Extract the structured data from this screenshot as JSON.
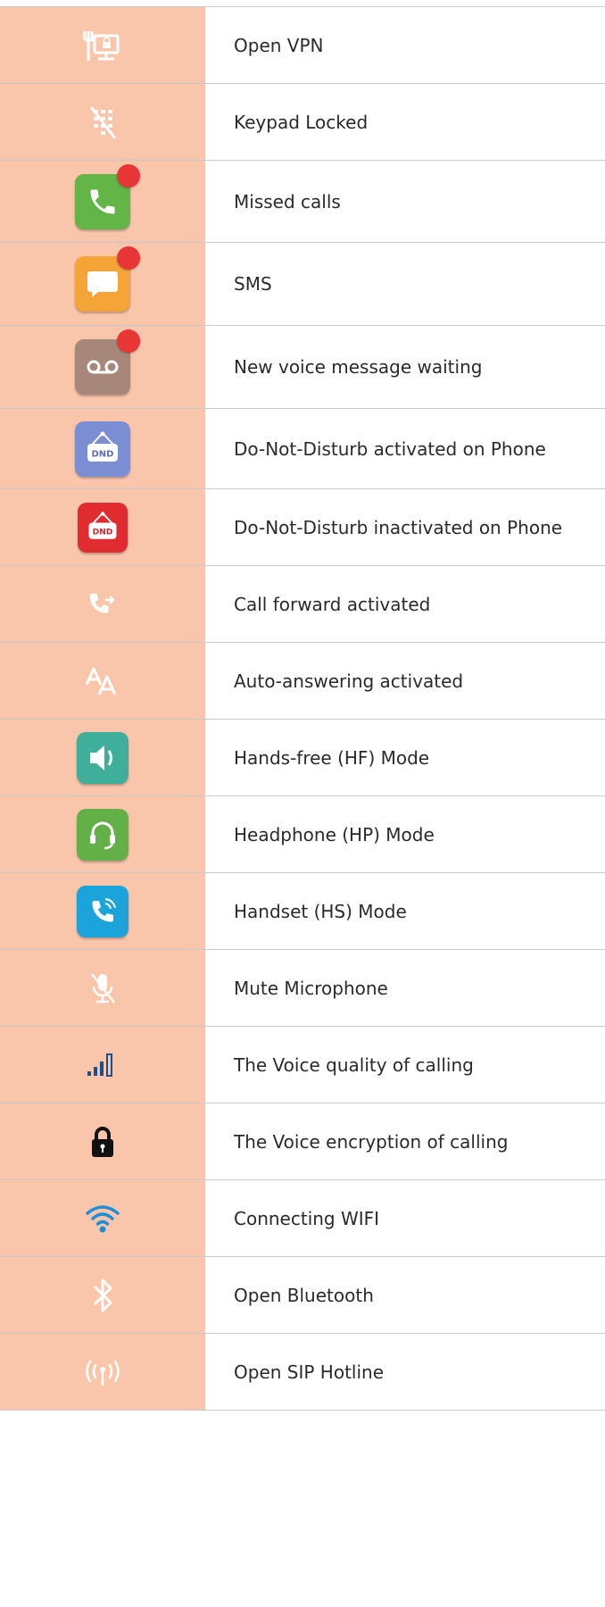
{
  "rows": [
    {
      "label": "Open VPN",
      "icon": "vpn-monitor-icon"
    },
    {
      "label": "Keypad Locked",
      "icon": "keypad-locked-icon"
    },
    {
      "label": "Missed calls",
      "icon": "missed-calls-icon"
    },
    {
      "label": "SMS",
      "icon": "sms-icon"
    },
    {
      "label": "New voice message waiting",
      "icon": "voicemail-icon"
    },
    {
      "label": "Do-Not-Disturb activated on Phone",
      "icon": "dnd-activated-icon",
      "badge_text": "DND"
    },
    {
      "label": "Do-Not-Disturb inactivated on Phone",
      "icon": "dnd-inactivated-icon",
      "badge_text": "DND"
    },
    {
      "label": "Call forward activated",
      "icon": "call-forward-icon"
    },
    {
      "label": "Auto-answering activated",
      "icon": "auto-answer-icon"
    },
    {
      "label": "Hands-free (HF) Mode",
      "icon": "speaker-icon"
    },
    {
      "label": "Headphone (HP) Mode",
      "icon": "headset-icon"
    },
    {
      "label": "Handset (HS) Mode",
      "icon": "handset-icon"
    },
    {
      "label": "Mute Microphone",
      "icon": "mute-microphone-icon"
    },
    {
      "label": "The Voice quality of calling",
      "icon": "signal-bars-icon"
    },
    {
      "label": "The Voice encryption of calling",
      "icon": "lock-icon"
    },
    {
      "label": "Connecting WIFI",
      "icon": "wifi-icon"
    },
    {
      "label": "Open Bluetooth",
      "icon": "bluetooth-icon"
    },
    {
      "label": "Open SIP Hotline",
      "icon": "sip-hotline-icon"
    }
  ],
  "colors": {
    "icon_cell_bg": "#f9c6ac",
    "missed_calls": "#63b548",
    "sms": "#f5a437",
    "voicemail": "#a7877a",
    "dnd_activated": "#7c8ed3",
    "dnd_inactivated": "#e02c31",
    "hands_free": "#3fae9a",
    "headphone": "#62b047",
    "handset": "#1ba3dc",
    "signal": "#1f4e8c",
    "wifi": "#1e8fd6",
    "badge": "#e83535"
  }
}
